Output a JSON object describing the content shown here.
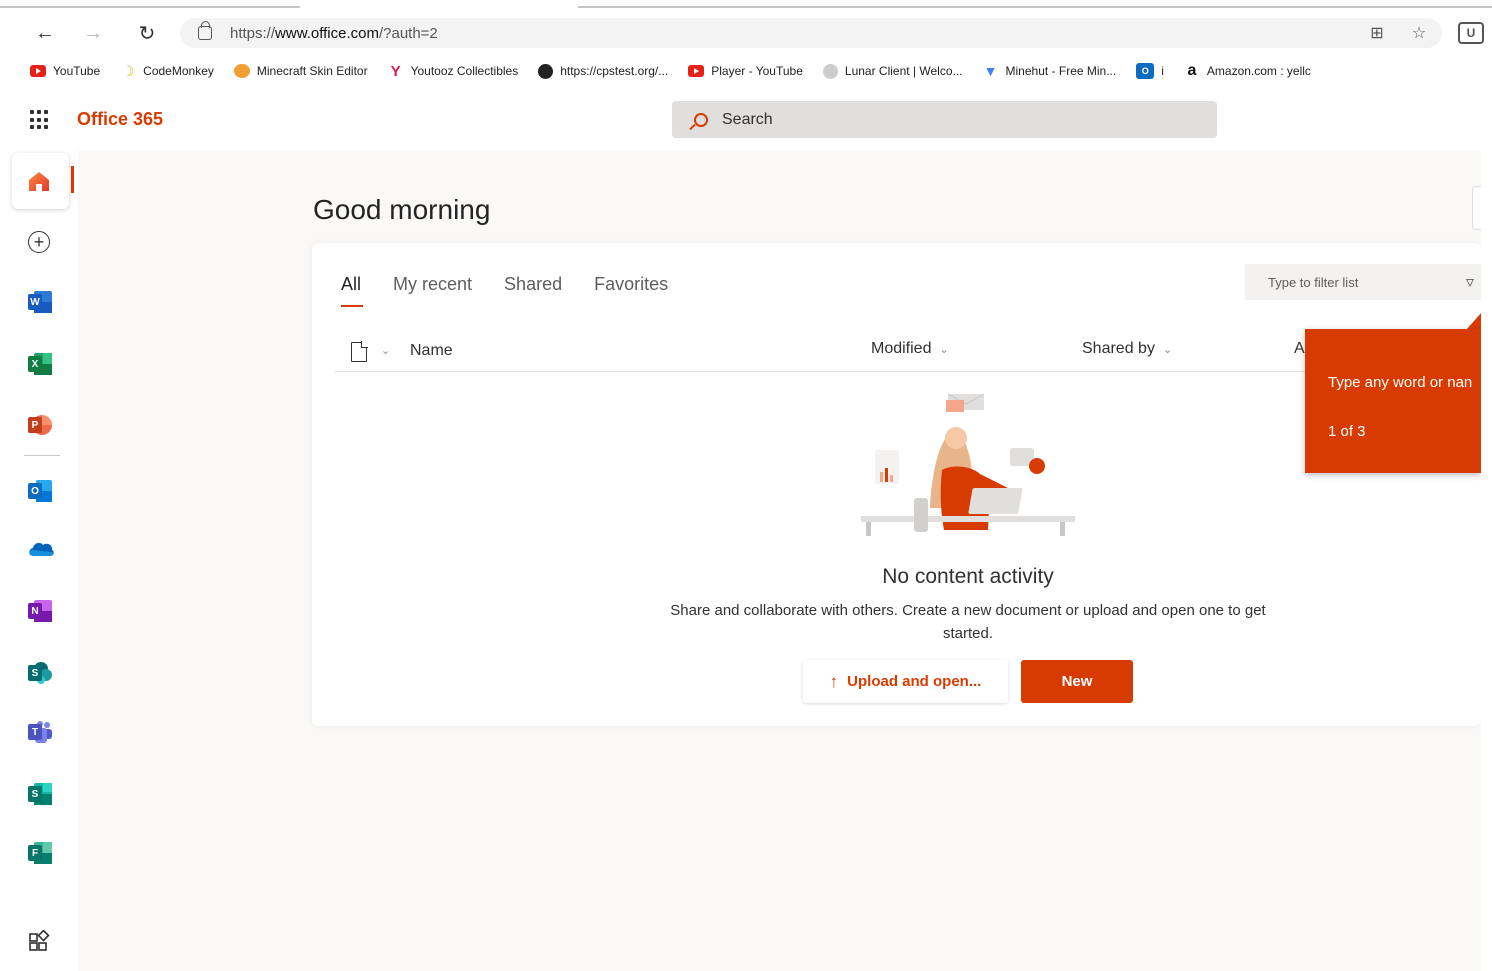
{
  "browser": {
    "url_prefix": "https://",
    "url_domain": "www.office.com",
    "url_path": "/?auth=2",
    "extension_label": "U"
  },
  "bookmarks": [
    {
      "label": "YouTube",
      "icon": "youtube-icon"
    },
    {
      "label": "CodeMonkey",
      "icon": "banana-icon"
    },
    {
      "label": "Minecraft Skin Editor",
      "icon": "pumpkin-icon"
    },
    {
      "label": "Youtooz Collectibles",
      "icon": "y-logo-icon"
    },
    {
      "label": "https://cpstest.org/...",
      "icon": "shield-icon"
    },
    {
      "label": "Player - YouTube",
      "icon": "youtube-icon"
    },
    {
      "label": "Lunar Client | Welco...",
      "icon": "lunar-icon"
    },
    {
      "label": "Minehut - Free Min...",
      "icon": "gem-icon"
    },
    {
      "label": "i",
      "icon": "outlook-icon"
    },
    {
      "label": "Amazon.com : yellc",
      "icon": "amazon-icon"
    }
  ],
  "header": {
    "brand": "Office 365",
    "search_label": "Search"
  },
  "main": {
    "greeting": "Good morning",
    "tabs": [
      {
        "label": "All",
        "active": true
      },
      {
        "label": "My recent",
        "active": false
      },
      {
        "label": "Shared",
        "active": false
      },
      {
        "label": "Favorites",
        "active": false
      }
    ],
    "filter_placeholder": "Type to filter list",
    "columns": {
      "name": "Name",
      "modified": "Modified",
      "shared_by": "Shared by",
      "activity": "A"
    },
    "empty_state": {
      "title": "No content activity",
      "description": "Share and collaborate with others. Create a new document or upload and open one to get started.",
      "upload_label": "Upload and open...",
      "new_label": "New"
    }
  },
  "callout": {
    "text": "Type any word or nan",
    "step": "1 of 3"
  },
  "colors": {
    "accent": "#d83b01",
    "word": "#185abd",
    "excel": "#107c41",
    "powerpoint": "#c43e1c",
    "outlook": "#0f6cbd",
    "onedrive": "#0364b8",
    "onenote": "#7719aa",
    "sharepoint": "#036c70",
    "teams": "#5b5fc7",
    "sway": "#008272",
    "forms": "#077568"
  }
}
